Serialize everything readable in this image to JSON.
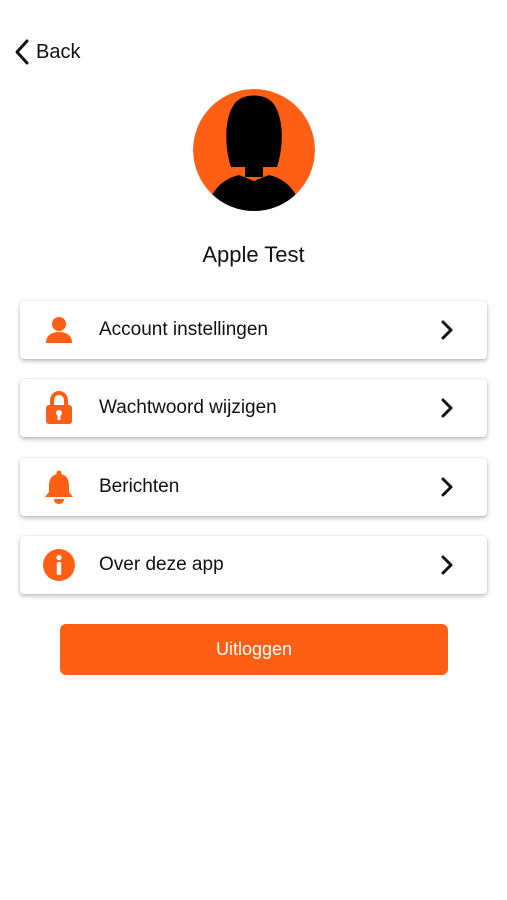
{
  "header": {
    "back_label": "Back",
    "back_icon": "chevron-left-icon"
  },
  "profile": {
    "name": "Apple Test",
    "avatar_icon": "user-silhouette-icon"
  },
  "menu": {
    "items": [
      {
        "label": "Account instellingen",
        "icon": "person-icon"
      },
      {
        "label": "Wachtwoord wijzigen",
        "icon": "lock-icon"
      },
      {
        "label": "Berichten",
        "icon": "bell-icon"
      },
      {
        "label": "Over deze app",
        "icon": "info-icon"
      }
    ]
  },
  "logout": {
    "label": "Uitloggen"
  },
  "colors": {
    "accent": "#ff5f14",
    "text": "#111111",
    "background": "#ffffff"
  }
}
